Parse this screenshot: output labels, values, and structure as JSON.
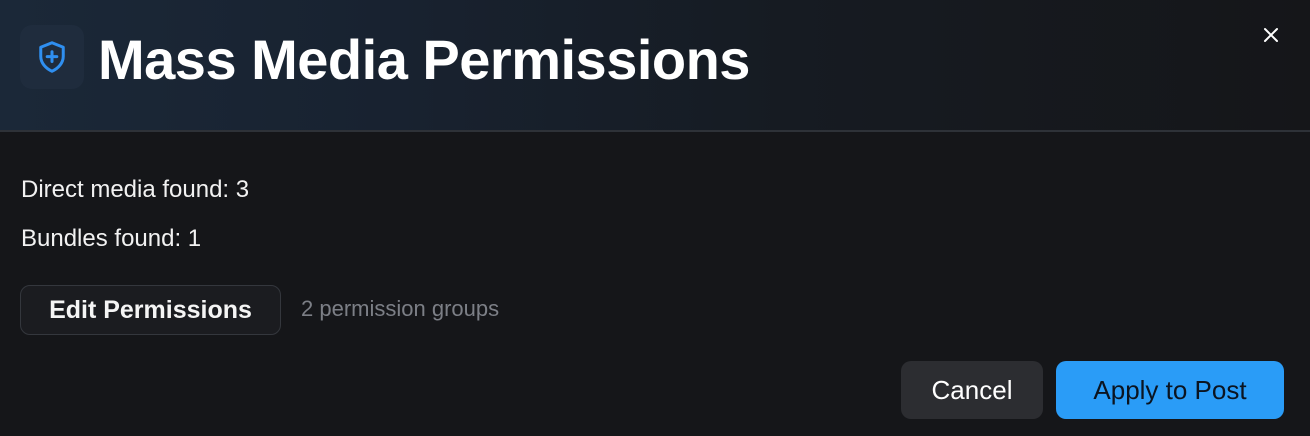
{
  "dialog": {
    "title": "Mass Media Permissions",
    "header_icon": "shield-plus-icon",
    "close_icon": "close-icon"
  },
  "info": {
    "direct_media": "Direct media found: 3",
    "bundles": "Bundles found: 1"
  },
  "permissions": {
    "edit_label": "Edit Permissions",
    "group_count": "2 permission groups"
  },
  "footer": {
    "cancel_label": "Cancel",
    "apply_label": "Apply to Post"
  },
  "colors": {
    "accent": "#2a9cf7",
    "background": "#151619",
    "icon_blue": "#2f8ff0"
  }
}
